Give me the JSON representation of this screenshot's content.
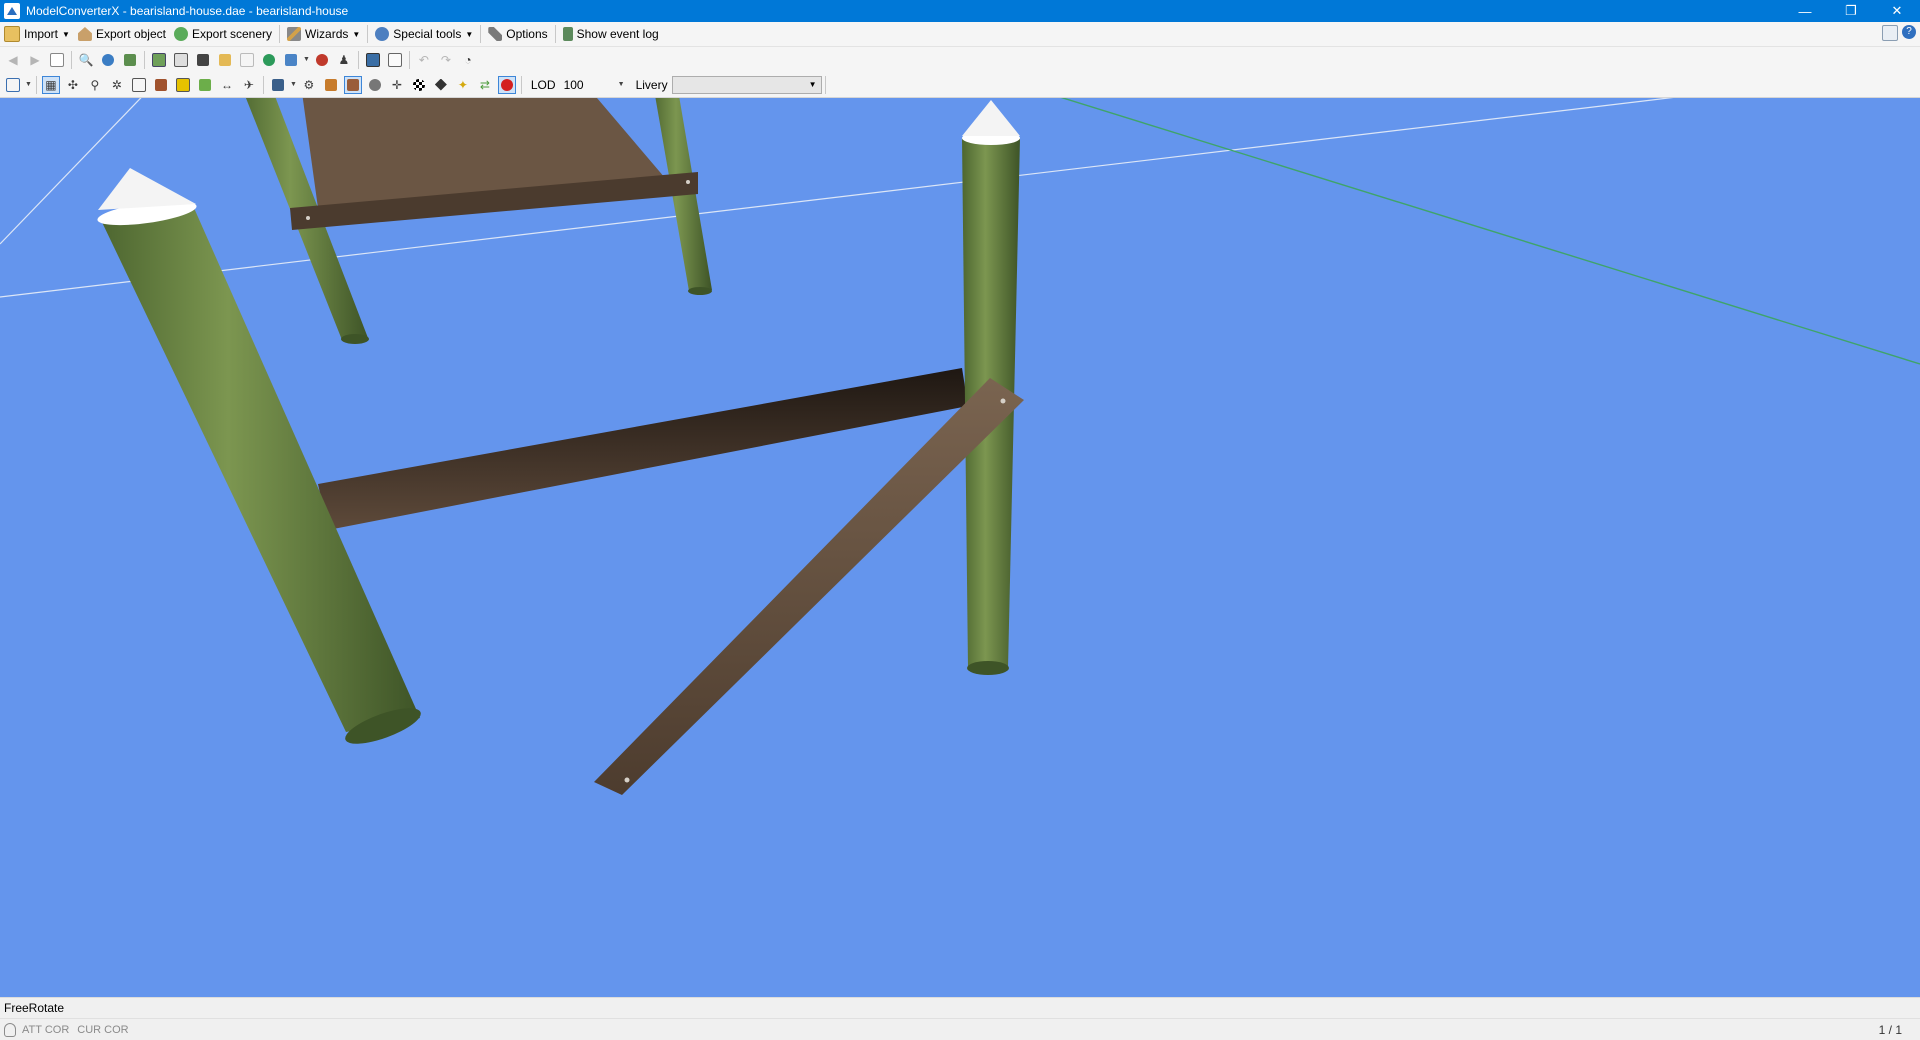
{
  "window": {
    "title": "ModelConverterX - bearisland-house.dae - bearisland-house",
    "controls": {
      "minimize": "—",
      "restore": "❐",
      "close": "✕"
    }
  },
  "menu": {
    "import": "Import",
    "export_object": "Export object",
    "export_scenery": "Export scenery",
    "wizards": "Wizards",
    "special_tools": "Special tools",
    "options": "Options",
    "show_event_log": "Show event log"
  },
  "toolbar2": {
    "lod_label": "LOD",
    "lod_value": "100",
    "livery_label": "Livery",
    "livery_value": ""
  },
  "icons": {
    "import": "folder-icon",
    "export_object": "house-icon",
    "export_scenery": "globe-icon",
    "wizards": "wand-icon",
    "special_tools": "gear-icon",
    "options": "wrench-icon",
    "event_log": "log-icon"
  },
  "colors": {
    "titlebar": "#0078d7",
    "viewport_background": "#6495ed",
    "pole_green": "#5f7a3c",
    "pole_cap": "#f4f4f4",
    "wood_brown": "#5a4636"
  },
  "status": {
    "mode": "FreeRotate",
    "att": "ATT COR",
    "cur": "CUR COR",
    "page": "1 / 1"
  }
}
